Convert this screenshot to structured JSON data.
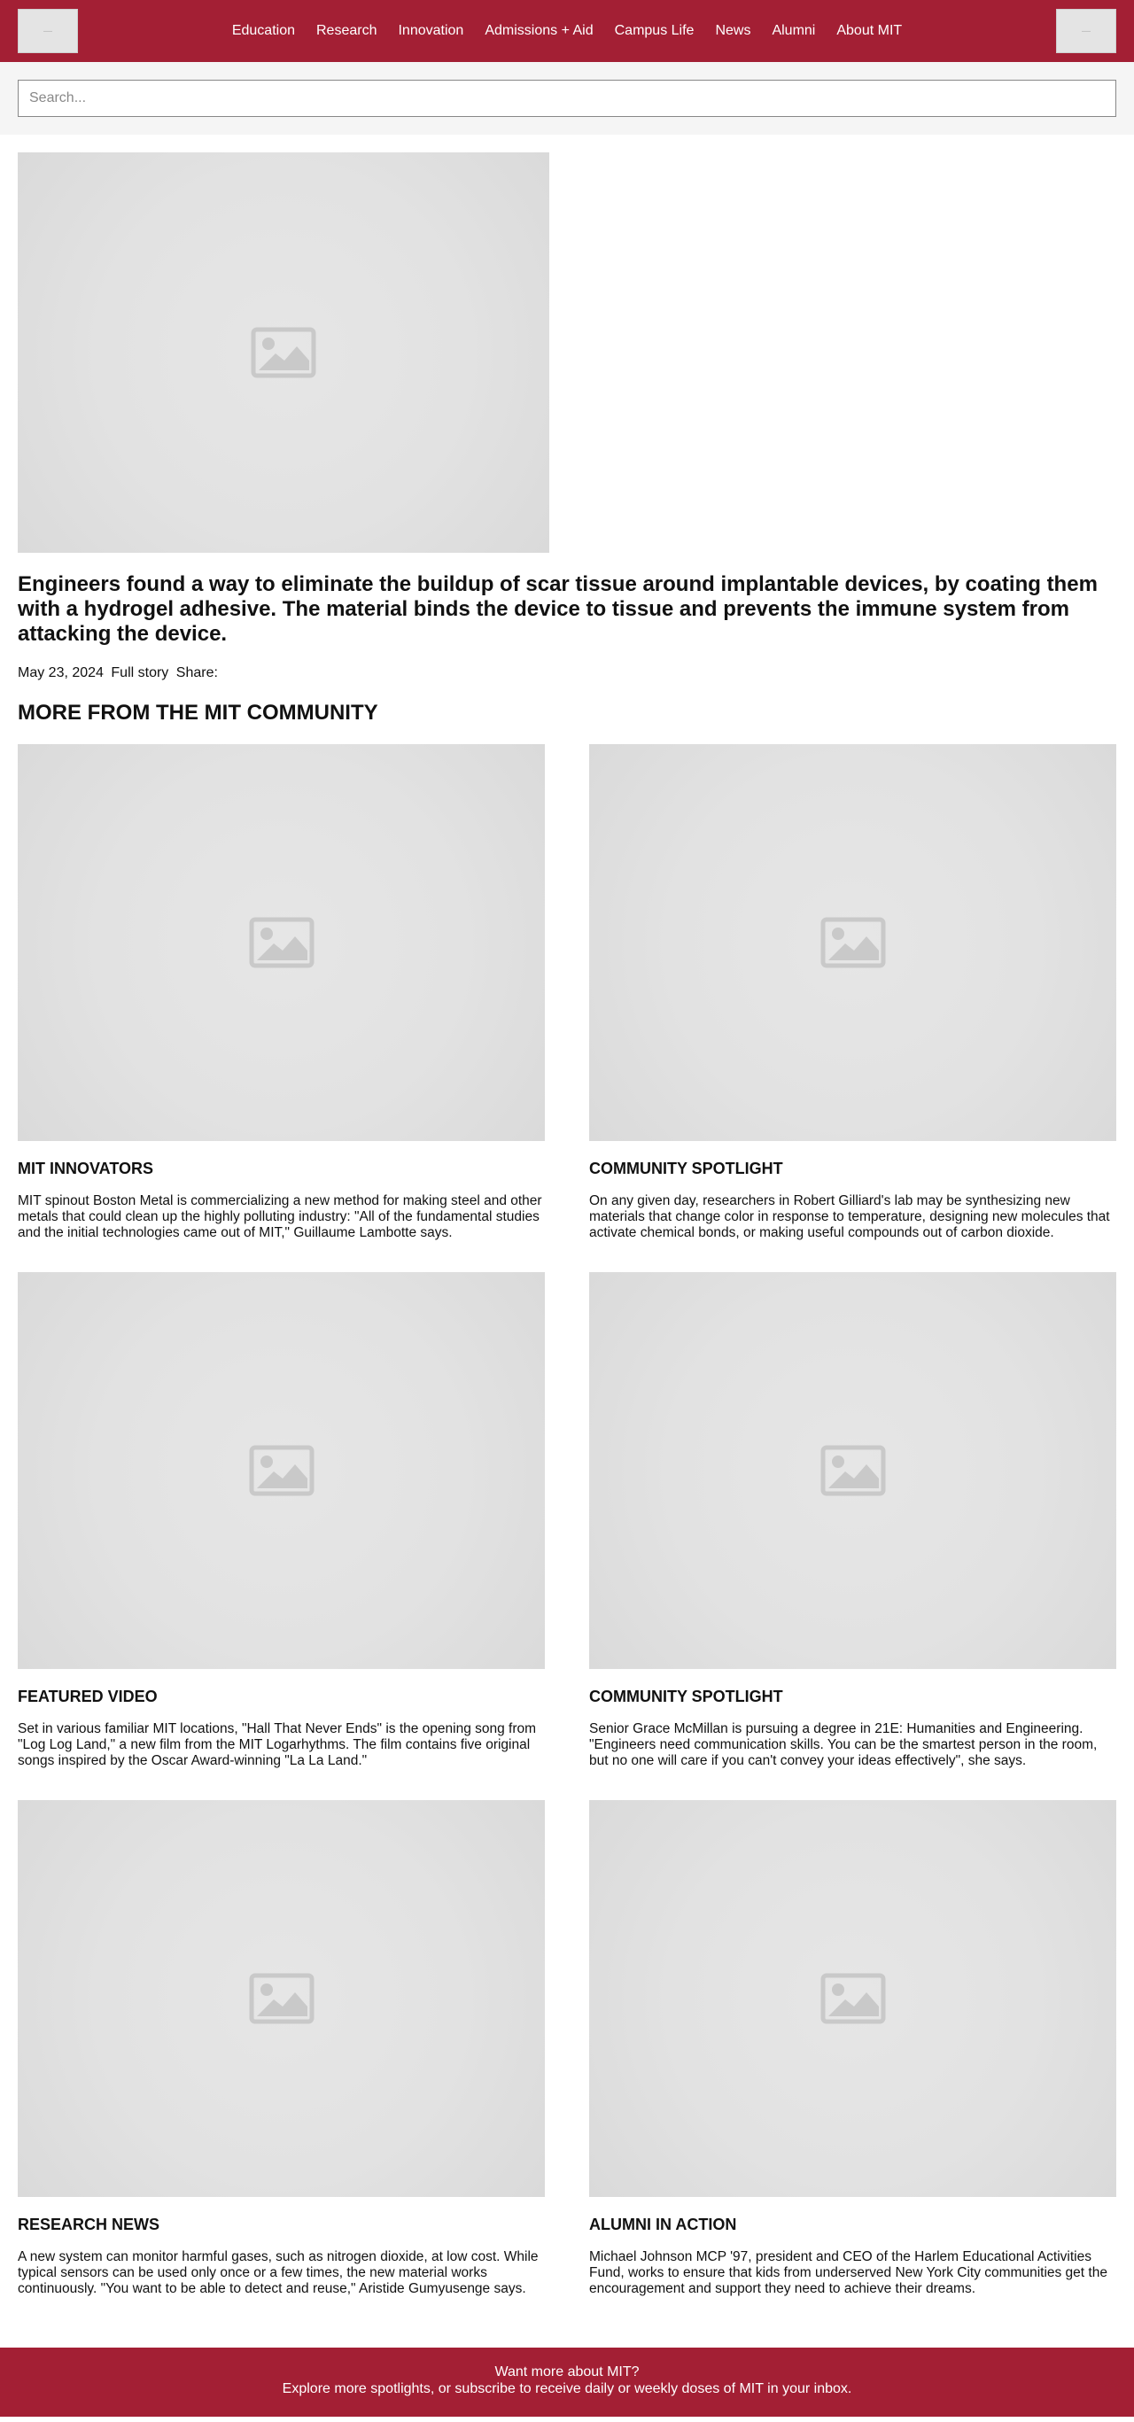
{
  "header": {
    "logo_left": "—",
    "logo_right": "—",
    "nav": [
      "Education",
      "Research",
      "Innovation",
      "Admissions + Aid",
      "Campus Life",
      "News",
      "Alumni",
      "About MIT"
    ]
  },
  "search": {
    "placeholder": "Search..."
  },
  "feature": {
    "headline": "Engineers found a way to eliminate the buildup of scar tissue around implantable devices, by coating them with a hydrogel adhesive. The material binds the device to tissue and prevents the immune system from attacking the device.",
    "date": "May 23, 2024",
    "full_story": "Full story",
    "share": "Share:"
  },
  "community": {
    "title": "MORE FROM THE MIT COMMUNITY",
    "cards": [
      {
        "category": "MIT INNOVATORS",
        "text": "MIT spinout Boston Metal is commercializing a new method for making steel and other metals that could clean up the highly polluting industry: \"All of the fundamental studies and the initial technologies came out of MIT,\" Guillaume Lambotte says."
      },
      {
        "category": "COMMUNITY SPOTLIGHT",
        "text": "On any given day, researchers in Robert Gilliard's lab may be synthesizing new materials that change color in response to temperature, designing new molecules that activate chemical bonds, or making useful compounds out of carbon dioxide."
      },
      {
        "category": "FEATURED VIDEO",
        "text": "Set in various familiar MIT locations, \"Hall That Never Ends\" is the opening song from \"Log Log Land,\" a new film from the MIT Logarhythms. The film contains five original songs inspired by the Oscar Award-winning \"La La Land.\""
      },
      {
        "category": "COMMUNITY SPOTLIGHT",
        "text": "Senior Grace McMillan is pursuing a degree in 21E: Humanities and Engineering. \"Engineers need communication skills. You can be the smartest person in the room, but no one will care if you can't convey your ideas effectively\", she says."
      },
      {
        "category": "RESEARCH NEWS",
        "text": "A new system can monitor harmful gases, such as nitrogen dioxide, at low cost. While typical sensors can be used only once or a few times, the new material works continuously. \"You want to be able to detect and reuse,\" Aristide Gumyusenge says."
      },
      {
        "category": "ALUMNI IN ACTION",
        "text": "Michael Johnson MCP '97, president and CEO of the Harlem Educational Activities Fund, works to ensure that kids from underserved New York City communities get the encouragement and support they need to achieve their dreams."
      }
    ]
  },
  "footer": {
    "line1": "Want more about MIT?",
    "line2": "Explore more spotlights, or subscribe to receive daily or weekly doses of MIT in your inbox."
  },
  "colors": {
    "brand": "#a31f34",
    "placeholder_bg": "#e3e3e3",
    "placeholder_icon": "#c9c9c9"
  },
  "icons": {
    "image_placeholder": "image-placeholder-icon"
  }
}
